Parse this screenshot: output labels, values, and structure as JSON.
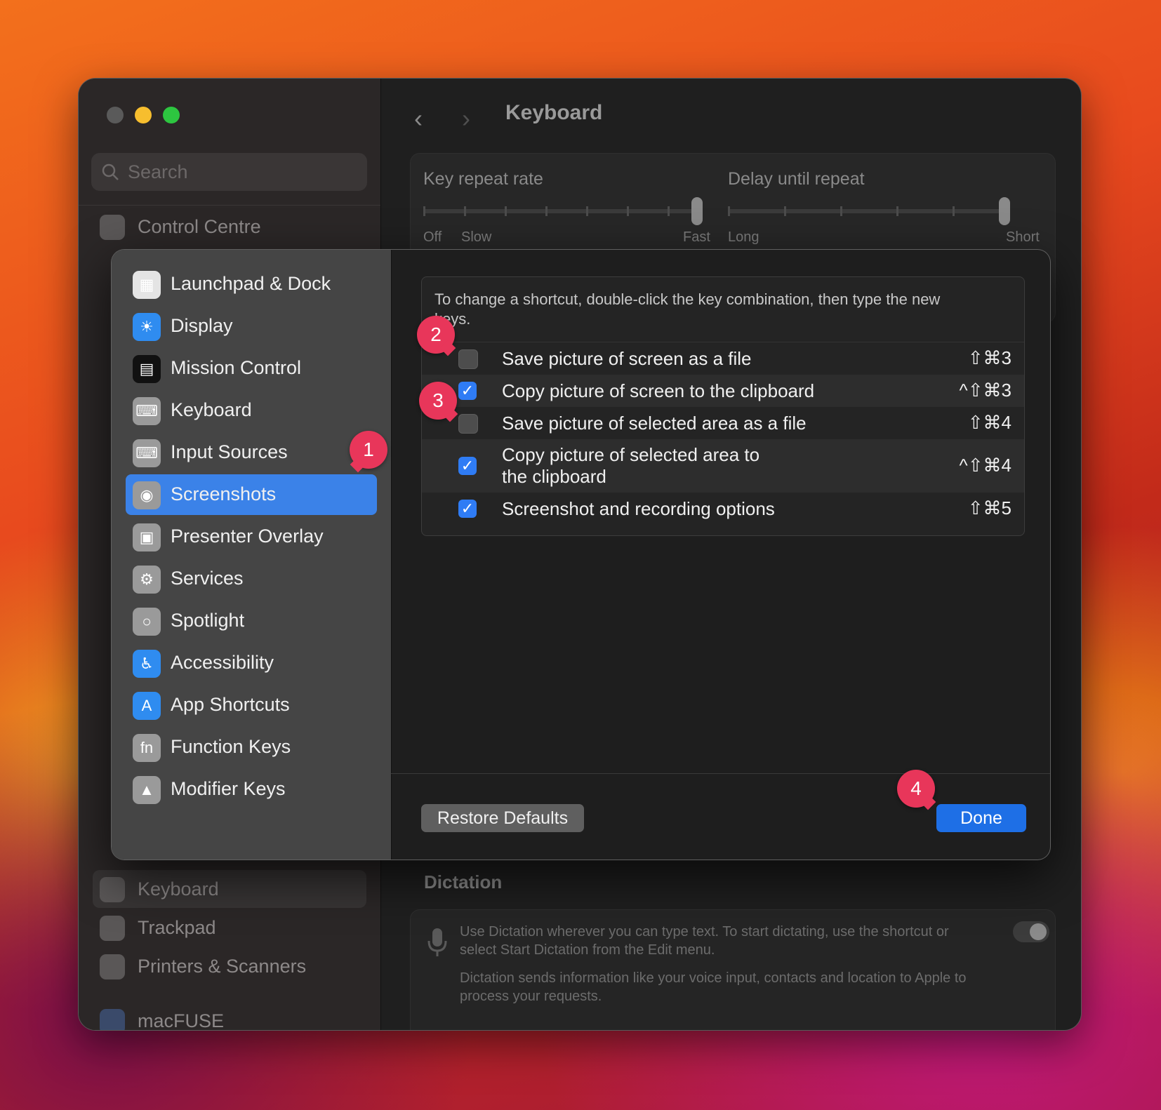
{
  "window": {
    "title": "Keyboard",
    "sidebar": {
      "search_placeholder": "Search",
      "items_top": [
        {
          "label": "Control Centre",
          "icon": "switches-icon"
        }
      ],
      "items_bottom": [
        {
          "label": "Keyboard",
          "icon": "keyboard-icon"
        },
        {
          "label": "Trackpad",
          "icon": "trackpad-icon"
        },
        {
          "label": "Printers & Scanners",
          "icon": "printer-icon"
        },
        {
          "label": "macFUSE",
          "icon": "fuse-icon"
        }
      ]
    },
    "key_repeat": {
      "rate_label": "Key repeat rate",
      "rate_left": "Off",
      "rate_slow": "Slow",
      "rate_right": "Fast",
      "delay_label": "Delay until repeat",
      "delay_left": "Long",
      "delay_right": "Short"
    },
    "dictation": {
      "heading": "Dictation",
      "line1": "Use Dictation wherever you can type text. To start dictating, use the shortcut or select Start Dictation from the Edit menu.",
      "line2": "Dictation sends information like your voice input, contacts and location to Apple to process your requests.",
      "enabled": false
    }
  },
  "sheet": {
    "categories": [
      {
        "label": "Launchpad & Dock",
        "icon": "launchpad-icon",
        "color": "#e4e4e4"
      },
      {
        "label": "Display",
        "icon": "display-brightness-icon",
        "color": "#2f8cf0"
      },
      {
        "label": "Mission Control",
        "icon": "mission-control-icon",
        "color": "#111111"
      },
      {
        "label": "Keyboard",
        "icon": "keyboard-icon",
        "color": "#9a9a9a"
      },
      {
        "label": "Input Sources",
        "icon": "input-sources-icon",
        "color": "#9a9a9a"
      },
      {
        "label": "Screenshots",
        "icon": "screenshot-icon",
        "color": "#9a9a9a",
        "selected": true
      },
      {
        "label": "Presenter Overlay",
        "icon": "presenter-overlay-icon",
        "color": "#9a9a9a"
      },
      {
        "label": "Services",
        "icon": "gears-icon",
        "color": "#9a9a9a"
      },
      {
        "label": "Spotlight",
        "icon": "magnifier-icon",
        "color": "#9a9a9a"
      },
      {
        "label": "Accessibility",
        "icon": "accessibility-icon",
        "color": "#2f8cf0"
      },
      {
        "label": "App Shortcuts",
        "icon": "app-store-icon",
        "color": "#2f8cf0"
      },
      {
        "label": "Function Keys",
        "icon": "fn-icon",
        "color": "#9a9a9a"
      },
      {
        "label": "Modifier Keys",
        "icon": "modifier-up-icon",
        "color": "#9a9a9a"
      }
    ],
    "hint": "To change a shortcut, double-click the key combination, then type the new keys.",
    "shortcuts": [
      {
        "label": "Save picture of screen as a file",
        "keys": "⇧⌘3",
        "checked": false
      },
      {
        "label": "Copy picture of screen to the clipboard",
        "keys": "^⇧⌘3",
        "checked": true
      },
      {
        "label": "Save picture of selected area as a file",
        "keys": "⇧⌘4",
        "checked": false
      },
      {
        "label": "Copy picture of selected area to the clipboard",
        "label_line1": "Copy picture of selected area to",
        "label_line2": "the clipboard",
        "keys": "^⇧⌘4",
        "checked": true
      },
      {
        "label": "Screenshot and recording options",
        "keys": "⇧⌘5",
        "checked": true
      }
    ],
    "restore_label": "Restore Defaults",
    "done_label": "Done"
  },
  "callouts": [
    "1",
    "2",
    "3",
    "4"
  ],
  "colors": {
    "accent": "#1e6fe6",
    "selection": "#3b82e8",
    "callout": "#e8365a"
  }
}
